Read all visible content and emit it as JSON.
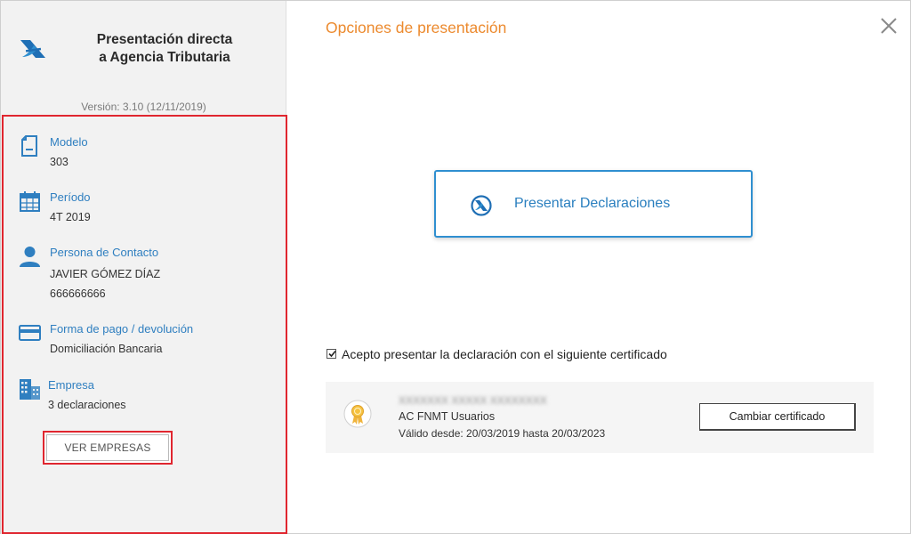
{
  "sidebar": {
    "app_title_line1": "Presentación directa",
    "app_title_line2": "a Agencia Tributaria",
    "logo_icon": "aeat-logo-icon",
    "version": "Versión: 3.10 (12/11/2019)",
    "items": [
      {
        "icon": "document-icon",
        "label": "Modelo",
        "values": [
          "303"
        ]
      },
      {
        "icon": "calendar-icon",
        "label": "Período",
        "values": [
          "4T 2019"
        ]
      },
      {
        "icon": "person-icon",
        "label": "Persona de Contacto",
        "values": [
          "JAVIER GÓMEZ DÍAZ",
          "666666666"
        ]
      },
      {
        "icon": "credit-card-icon",
        "label": "Forma de pago / devolución",
        "values": [
          "Domiciliación Bancaria"
        ]
      },
      {
        "icon": "building-icon",
        "label": "Empresa",
        "values": [
          "3 declaraciones"
        ]
      }
    ],
    "ver_empresas_label": "VER EMPRESAS"
  },
  "main": {
    "title": "Opciones de presentación",
    "close_icon": "close-icon",
    "present_button_label": "Presentar Declaraciones",
    "accept_checked": true,
    "accept_label": "Acepto presentar la declaración con el siguiente certificado",
    "certificate": {
      "holder_name_blurred": "XXXXXXX XXXXX XXXXXXXX",
      "issuer": "AC FNMT Usuarios",
      "validity": "Válido desde: 20/03/2019 hasta 20/03/2023",
      "change_button_label": "Cambiar certificado"
    }
  },
  "colors": {
    "accent_blue": "#2f7fc0",
    "title_orange": "#ec8a2e",
    "highlight_red": "#e0262f",
    "sidebar_bg": "#f2f2f2"
  }
}
